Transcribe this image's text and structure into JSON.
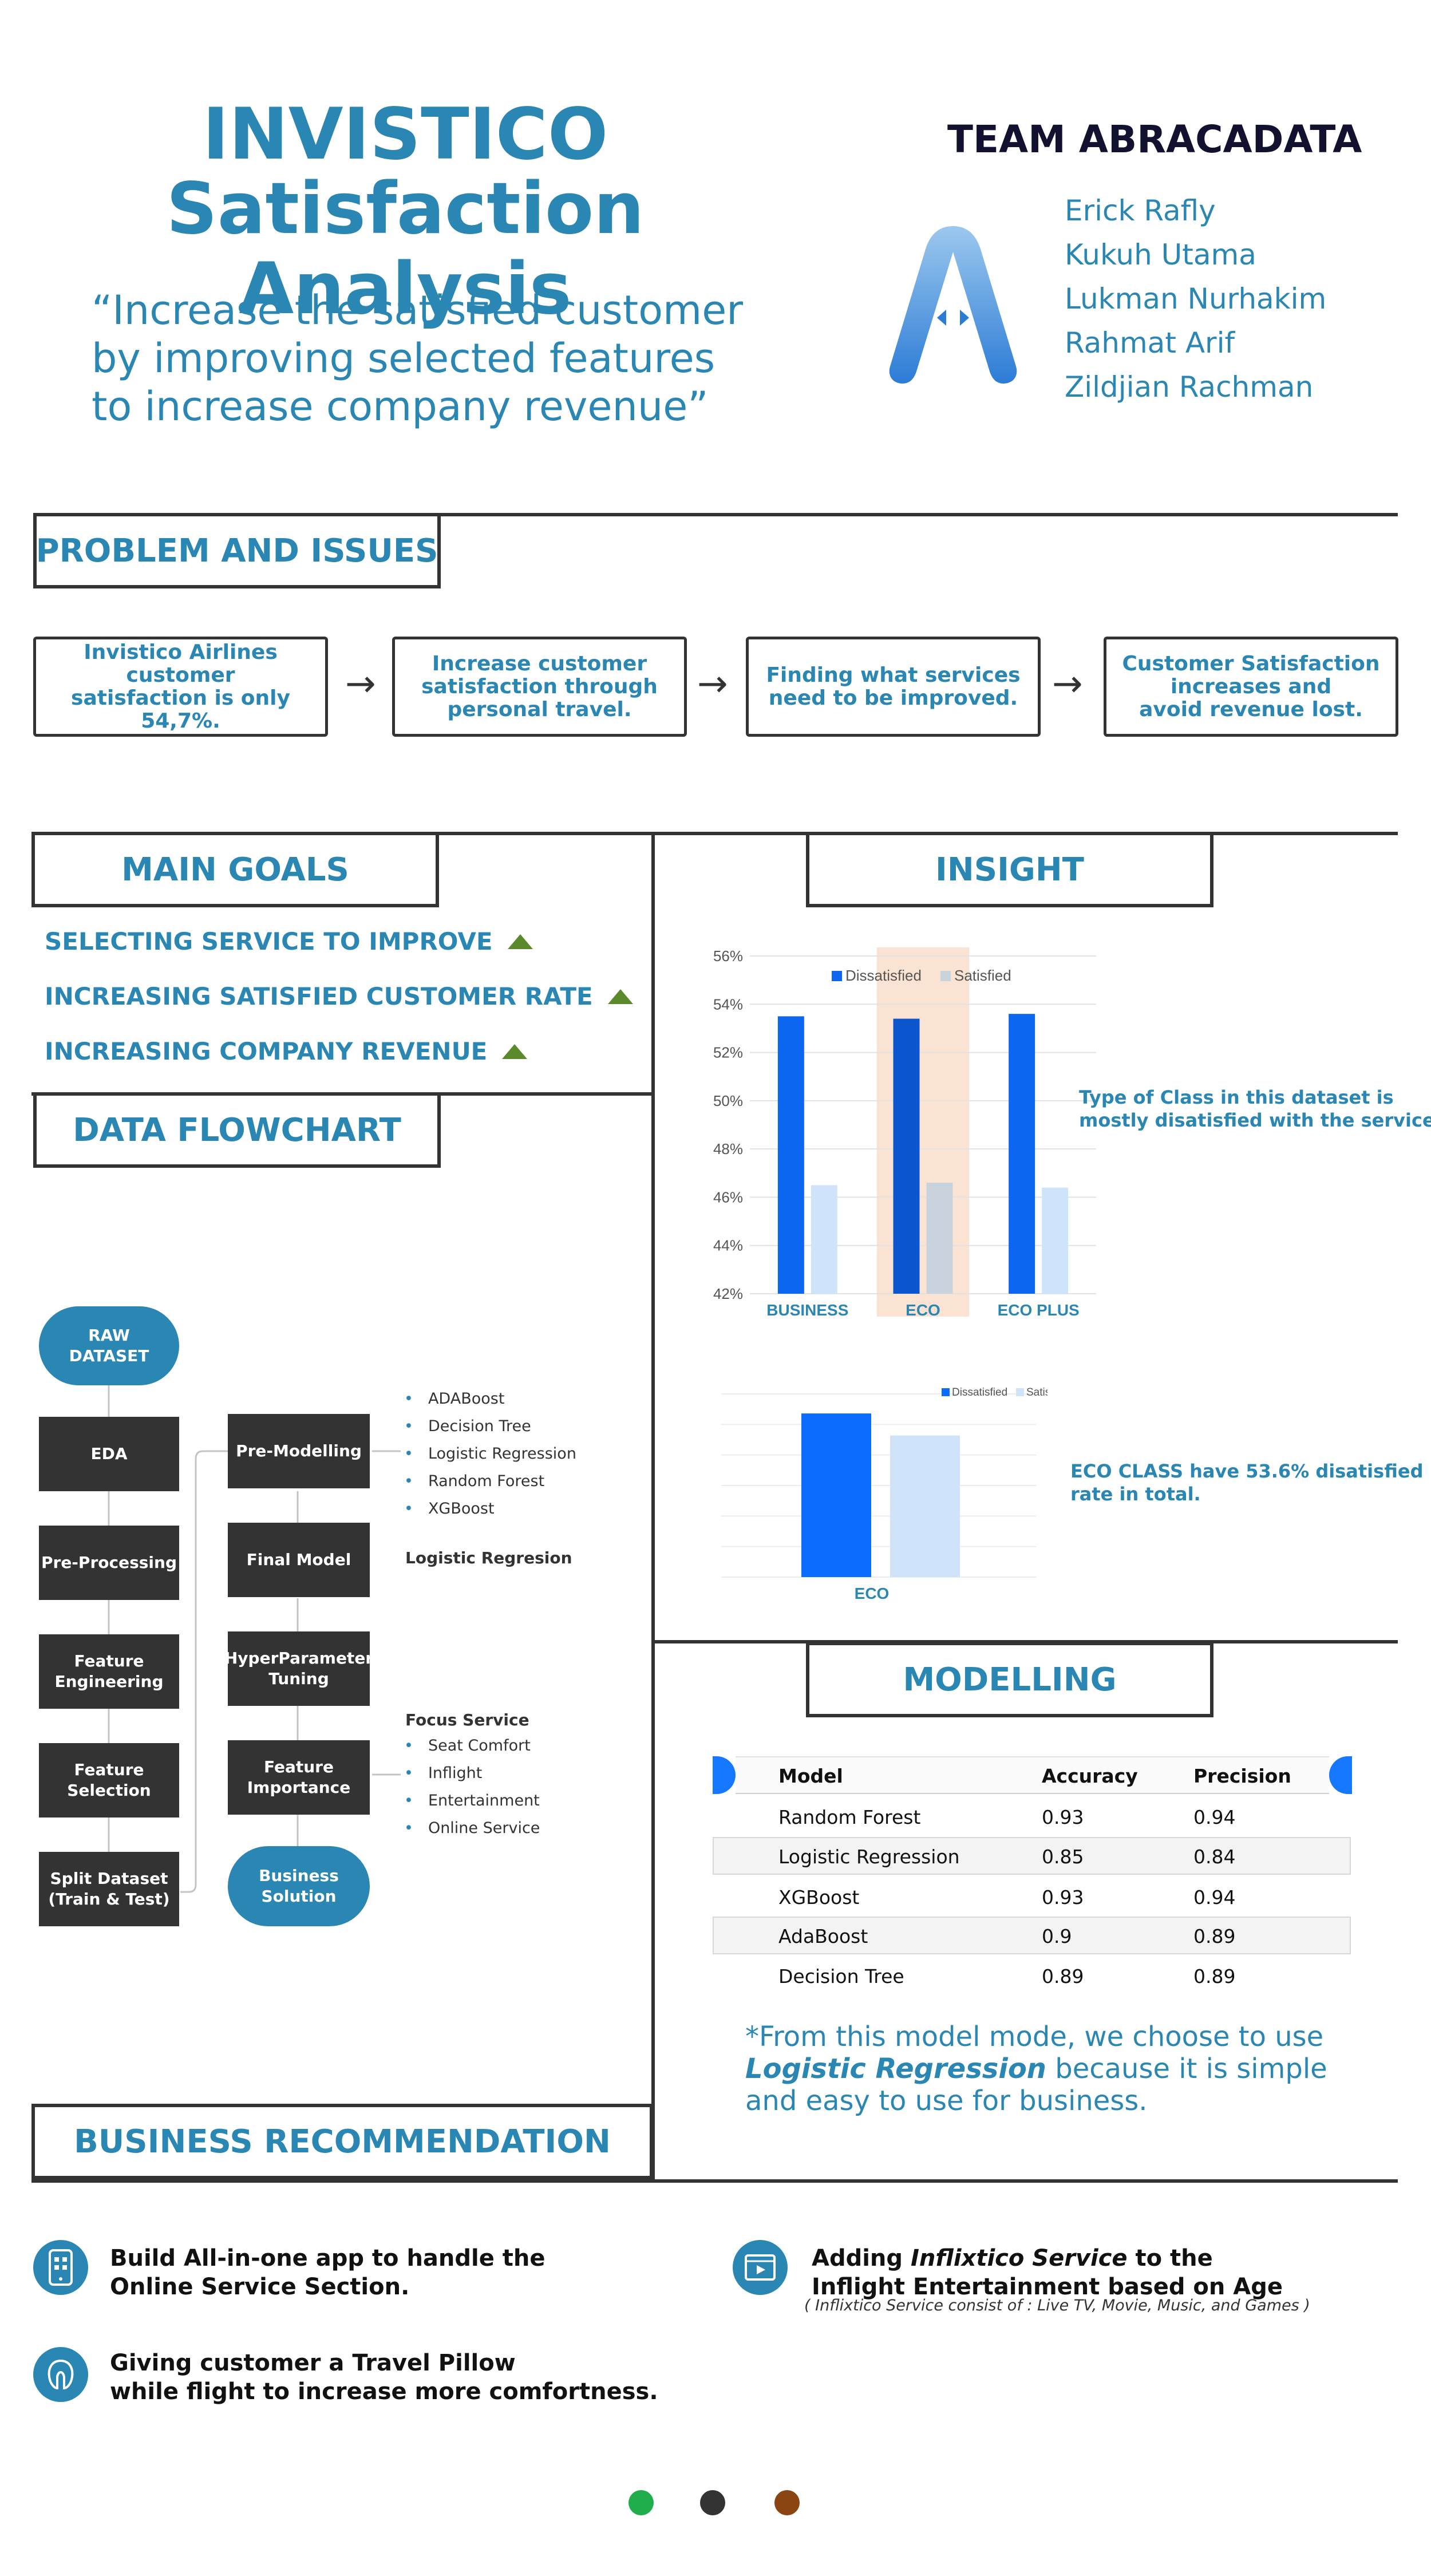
{
  "header": {
    "title_line1": "INVISTICO",
    "title_line2": "Satisfaction Analysis",
    "tagline": [
      "“Increase the satisfied customer",
      "by improving selected features",
      "to increase company revenue”"
    ]
  },
  "team": {
    "title": "TEAM ABRACADATA",
    "members": [
      "Erick Rafly",
      "Kukuh Utama",
      "Lukman Nurhakim",
      "Rahmat Arif",
      "Zildjian Rachman"
    ]
  },
  "problem": {
    "heading": "PROBLEM AND ISSUES",
    "steps": [
      "Invistico Airlines customer\nsatisfaction is only 54,7%.",
      "Increase customer\nsatisfaction through\npersonal travel.",
      "Finding what services\nneed to be improved.",
      "Customer Satisfaction\nincreases and\navoid revenue lost."
    ]
  },
  "goals": {
    "heading": "MAIN GOALS",
    "items": [
      "SELECTING SERVICE TO IMPROVE",
      "INCREASING SATISFIED CUSTOMER RATE",
      "INCREASING COMPANY REVENUE"
    ]
  },
  "flowchart": {
    "heading": "DATA FLOWCHART",
    "raw": "RAW\nDATASET",
    "left_nodes": [
      "EDA",
      "Pre-Processing",
      "Feature\nEngineering",
      "Feature\nSelection",
      "Split Dataset\n(Train & Test)"
    ],
    "right_nodes": [
      "Pre-Modelling",
      "Final Model",
      "HyperParameter\nTuning",
      "Feature\nImportance"
    ],
    "solution": "Business\nSolution",
    "models": [
      "ADABoost",
      "Decision Tree",
      "Logistic Regression",
      "Random Forest",
      "XGBoost"
    ],
    "final_model_label": "Logistic Regresion",
    "focus_title": "Focus Service",
    "focus_items": [
      "Seat Comfort",
      "Inflight",
      "Entertainment",
      "Online Service"
    ]
  },
  "insight": {
    "heading": "INSIGHT",
    "note1": [
      "Type of Class in this dataset is",
      "mostly disatisfied with the service."
    ],
    "note2": [
      "ECO CLASS have 53.6% disatisfied",
      "rate in total."
    ]
  },
  "chart_data": [
    {
      "type": "bar",
      "categories": [
        "BUSINESS",
        "ECO",
        "ECO PLUS"
      ],
      "series": [
        {
          "name": "Dissatisfied",
          "values": [
            53.5,
            53.4,
            53.6
          ]
        },
        {
          "name": "Satisfied",
          "values": [
            46.5,
            46.6,
            46.4
          ]
        }
      ],
      "yticks": [
        "42%",
        "44%",
        "46%",
        "48%",
        "50%",
        "52%",
        "54%",
        "56%"
      ],
      "ylim": [
        42,
        56
      ],
      "highlight": "ECO",
      "legend": "top",
      "grid": true,
      "colors": {
        "dissatisfied": "#0c66f0",
        "satisfied": "#cfe4fa",
        "highlight": "#fbe3d3"
      }
    },
    {
      "type": "bar",
      "categories": [
        "ECO"
      ],
      "series": [
        {
          "name": "Dissatisfied",
          "values": [
            53.6
          ]
        },
        {
          "name": "Satisfied",
          "values": [
            46.4
          ]
        }
      ],
      "ylim": [
        0,
        60
      ],
      "legend": "top-right",
      "grid": true
    }
  ],
  "modelling": {
    "heading": "MODELLING",
    "columns": [
      "Model",
      "Accuracy",
      "Precision"
    ],
    "rows": [
      [
        "Random Forest",
        "0.93",
        "0.94"
      ],
      [
        "Logistic Regression",
        "0.85",
        "0.84"
      ],
      [
        "XGBoost",
        "0.93",
        "0.94"
      ],
      [
        "AdaBoost",
        "0.9",
        "0.89"
      ],
      [
        "Decision Tree",
        "0.89",
        "0.89"
      ]
    ],
    "note_line1": "*From this model mode, we choose to use",
    "note_bold": "Logistic Regression",
    "note_line2_rest": " because it is simple",
    "note_line3": "and easy to use for business."
  },
  "recommendation": {
    "heading": "BUSINESS RECOMMENDATION",
    "items": [
      {
        "lines": [
          "Build All-in-one app to handle the",
          "Online Service Section."
        ],
        "icon": "mobile-app-icon"
      },
      {
        "lines": [
          "Giving customer a Travel Pillow",
          "while flight to increase more comfortness."
        ],
        "icon": "travel-pillow-icon"
      }
    ],
    "item3_line1_pre": "Adding ",
    "item3_line1_em": "Inflixtico Service",
    "item3_line1_post": " to the",
    "item3_line2": "Inflight Entertainment based on Age",
    "item3_sub": "( Inflixtico Service consist of : Live TV, Movie, Music, and Games )"
  },
  "footer_dots": [
    "#1fae4b",
    "#333333",
    "#8b4513"
  ]
}
